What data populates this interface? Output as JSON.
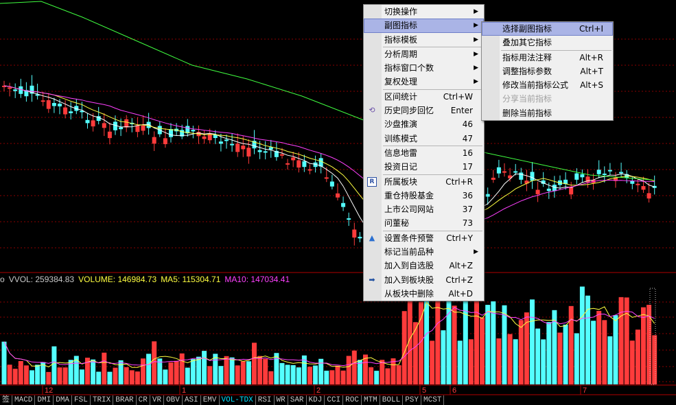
{
  "volume_header": {
    "prefix": "o",
    "vvol": "VVOL: 259384.83",
    "volume": "VOLUME: 146984.73",
    "ma5": "MA5: 115304.71",
    "ma10": "MA10: 147034.41"
  },
  "date_labels": [
    "12",
    "1",
    "2",
    "5",
    "6",
    "7"
  ],
  "indicator_tabs": [
    "签",
    "MACD",
    "DMI",
    "DMA",
    "FSL",
    "TRIX",
    "BRAR",
    "CR",
    "VR",
    "OBV",
    "ASI",
    "EMV",
    "VOL-TDX",
    "RSI",
    "WR",
    "SAR",
    "KDJ",
    "CCI",
    "ROC",
    "MTM",
    "BOLL",
    "PSY",
    "MCST"
  ],
  "active_tab": "VOL-TDX",
  "context_menu": {
    "items": [
      {
        "label": "切换操作",
        "submenu": true
      },
      {
        "label": "副图指标",
        "submenu": true,
        "highlight": true
      },
      {
        "label": "指标模板",
        "submenu": true
      },
      {
        "sep": true
      },
      {
        "label": "分析周期",
        "submenu": true
      },
      {
        "label": "指标窗口个数",
        "submenu": true
      },
      {
        "label": "复权处理",
        "submenu": true
      },
      {
        "sep": true
      },
      {
        "label": "区间统计",
        "shortcut": "Ctrl+W"
      },
      {
        "label": "历史同步回忆",
        "shortcut": "Enter",
        "icon": "history-sync-icon"
      },
      {
        "label": "沙盘推演",
        "shortcut": "46"
      },
      {
        "label": "训练模式",
        "shortcut": "47"
      },
      {
        "sep": true
      },
      {
        "label": "信息地雷",
        "shortcut": "16"
      },
      {
        "label": "投资日记",
        "shortcut": "17"
      },
      {
        "sep": true
      },
      {
        "label": "所属板块",
        "shortcut": "Ctrl+R",
        "icon": "sector-r-icon"
      },
      {
        "label": "重仓持股基金",
        "shortcut": "36"
      },
      {
        "label": "上市公司网站",
        "shortcut": "37"
      },
      {
        "label": "问董秘",
        "shortcut": "73"
      },
      {
        "sep": true
      },
      {
        "label": "设置条件预警",
        "shortcut": "Ctrl+Y",
        "icon": "alert-up-icon"
      },
      {
        "label": "标记当前品种",
        "submenu": true
      },
      {
        "label": "加入到自选股",
        "shortcut": "Alt+Z"
      },
      {
        "label": "加入到板块股",
        "shortcut": "Ctrl+Z",
        "icon": "add-to-sector-icon"
      },
      {
        "label": "从板块中删除",
        "shortcut": "Alt+D"
      }
    ]
  },
  "submenu": {
    "items": [
      {
        "label": "选择副图指标",
        "shortcut": "Ctrl+I",
        "highlight": true
      },
      {
        "label": "叠加其它指标"
      },
      {
        "sep": true
      },
      {
        "label": "指标用法注释",
        "shortcut": "Alt+R"
      },
      {
        "label": "调整指标参数",
        "shortcut": "Alt+T"
      },
      {
        "label": "修改当前指标公式",
        "shortcut": "Alt+S"
      },
      {
        "label": "分享当前指标",
        "disabled": true
      },
      {
        "label": "删除当前指标"
      }
    ]
  },
  "colors": {
    "up": "#ff3b3b",
    "down": "#54ffff",
    "ma_white": "#ffffff",
    "ma_yellow": "#ffff40",
    "ma_magenta": "#ff40ff",
    "ma_green": "#40ff40",
    "grid": "#8b0000",
    "vvol": "#c8c8c8",
    "volume": "#ffff40",
    "ma5": "#ffff40",
    "ma10": "#ff40ff"
  }
}
